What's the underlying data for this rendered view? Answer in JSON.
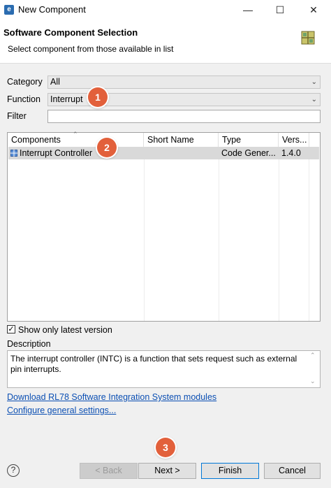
{
  "window": {
    "title": "New Component",
    "app_icon": "renesas-e2-icon",
    "controls": [
      "minimize",
      "maximize",
      "close"
    ]
  },
  "header": {
    "title": "Software Component Selection",
    "subtitle": "Select component from those available in list",
    "icon": "component-grid-icon"
  },
  "form": {
    "category_label": "Category",
    "category_value": "All",
    "function_label": "Function",
    "function_value": "Interrupt",
    "filter_label": "Filter",
    "filter_value": ""
  },
  "table": {
    "columns": [
      "Components",
      "Short Name",
      "Type",
      "Vers..."
    ],
    "rows": [
      {
        "component": "Interrupt Controller",
        "short_name": "",
        "type": "Code Gener...",
        "version": "1.4.0"
      }
    ]
  },
  "show_latest": {
    "label": "Show only latest version",
    "checked": true,
    "mark": "✓"
  },
  "description": {
    "label": "Description",
    "text": "The interrupt controller (INTC) is a function that sets request such as external pin interrupts."
  },
  "links": {
    "download": "Download RL78 Software Integration System modules",
    "configure": "Configure general settings..."
  },
  "buttons": {
    "back": "< Back",
    "next": "Next >",
    "finish": "Finish",
    "cancel": "Cancel",
    "help": "?"
  },
  "annotations": [
    "1",
    "2",
    "3"
  ],
  "colors": {
    "badge": "#e2603b",
    "link": "#0b4fb3",
    "selected_row": "#d9d9d9"
  }
}
